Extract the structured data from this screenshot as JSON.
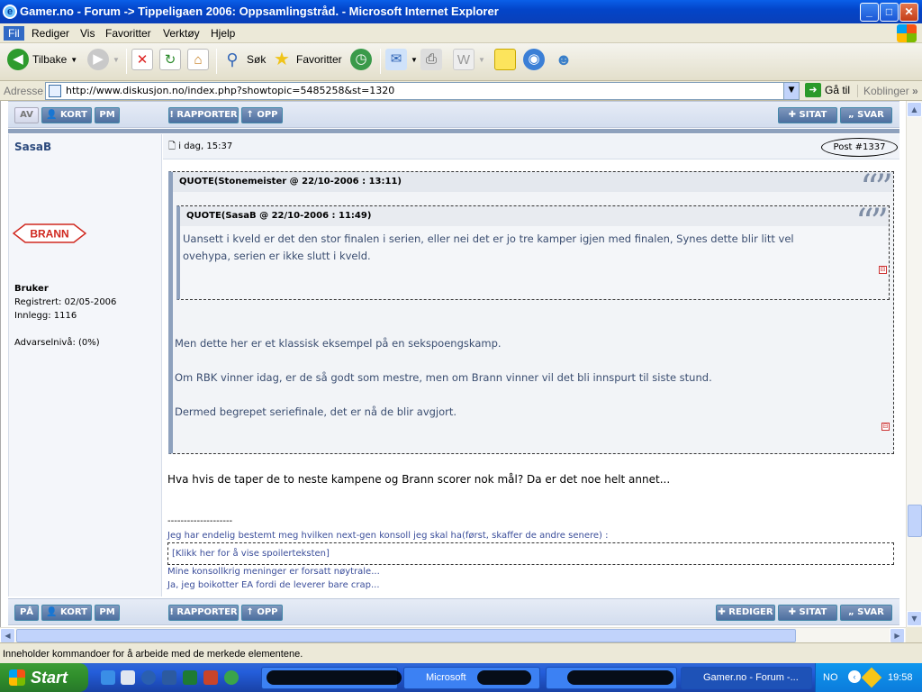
{
  "window": {
    "title": "Gamer.no - Forum -> Tippeligaen 2006: Oppsamlingstråd. - Microsoft Internet Explorer",
    "controls": {
      "min": "_",
      "max": "□",
      "close": "✕"
    }
  },
  "menu": [
    "Fil",
    "Rediger",
    "Vis",
    "Favoritter",
    "Verktøy",
    "Hjelp"
  ],
  "toolbar": {
    "back": "Tilbake",
    "search": "Søk",
    "favorites": "Favoritter"
  },
  "address": {
    "label": "Adresse",
    "url": "http://www.diskusjon.no/index.php?showtopic=5485258&st=1320",
    "go": "Gå til",
    "links": "Koblinger"
  },
  "topbar": {
    "left_buttons": [
      "AV",
      "KORT",
      "PM"
    ],
    "mid_buttons": [
      "RAPPORTER",
      "OPP"
    ],
    "right_buttons": [
      "SITAT",
      "SVAR"
    ]
  },
  "post": {
    "author": "SasaB",
    "club_logo": "BRANN",
    "rank": "Bruker",
    "registered": "Registrert: 02/05-2006",
    "posts": "Innlegg: 1116",
    "warning": "Advarselnivå: (0%)",
    "date": "i dag, 15:37",
    "post_number": "Post #1337",
    "outer_quote": {
      "header": "QUOTE(Stonemeister @ 22/10-2006 : 13:11)",
      "lines": [
        "Men dette her er et klassisk eksempel på en sekspoengskamp.",
        "Om RBK vinner idag, er de så godt som mestre, men om Brann vinner vil det bli innspurt til siste stund.",
        "Dermed begrepet seriefinale, det er nå de blir avgjort."
      ]
    },
    "inner_quote": {
      "header": "QUOTE(SasaB @ 22/10-2006 : 11:49)",
      "line1": "Uansett i kveld er det den stor finalen i serien, eller nei det er jo tre kamper igjen med finalen, Synes dette blir litt vel",
      "line2": "ovehypa, serien er ikke slutt i kveld."
    },
    "body": "Hva hvis de taper de to neste kampene og Brann scorer nok mål? Da er det noe helt annet...",
    "signature": {
      "divider": "--------------------",
      "line1": "Jeg har endelig bestemt meg hvilken next-gen konsoll jeg skal ha(først, skaffer de andre senere) :",
      "spoiler": "[Klikk her for å vise spoilerteksten]",
      "line2": "Mine konsollkrig meninger er forsatt nøytrale...",
      "line3": "Ja, jeg boikotter EA fordi de leverer bare crap..."
    }
  },
  "bottombar": {
    "left_buttons": [
      "PÅ",
      "KORT",
      "PM"
    ],
    "mid_buttons": [
      "RAPPORTER",
      "OPP"
    ],
    "right_buttons": [
      "REDIGER",
      "SITAT",
      "SVAR"
    ]
  },
  "status": "Inneholder kommandoer for å arbeide med de merkede elementene.",
  "taskbar": {
    "start": "Start",
    "task_active": "Gamer.no - Forum -...",
    "task_other": "Microsoft",
    "lang": "NO",
    "clock": "19:58"
  }
}
